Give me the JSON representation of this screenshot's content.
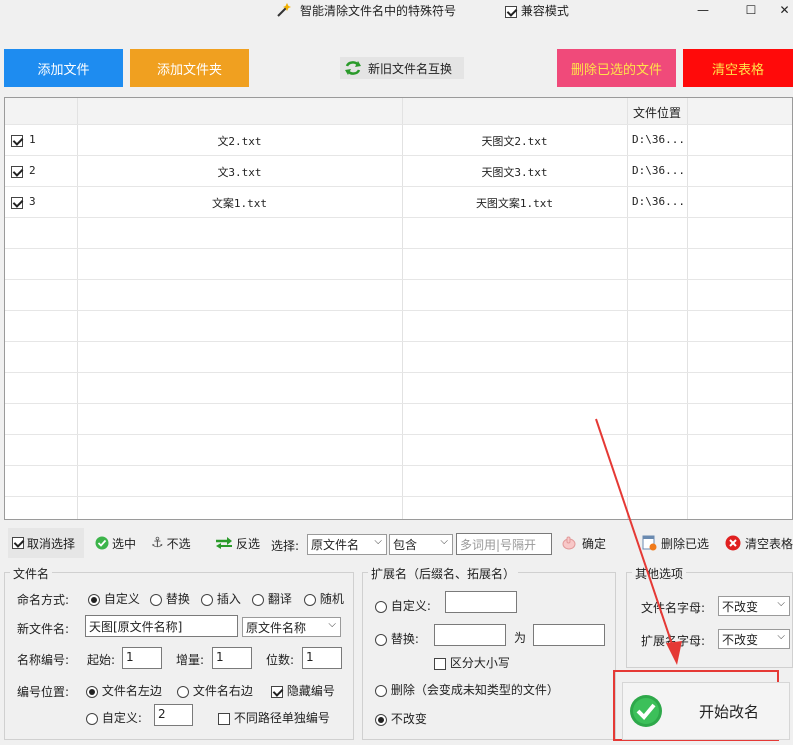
{
  "title": "智能清除文件名中的特殊符号",
  "compat_label": "兼容模式",
  "window": {
    "min": "—",
    "max": "☐",
    "close": "✕"
  },
  "buttons": {
    "add_file": "添加文件",
    "add_folder": "添加文件夹",
    "swap_names": "新旧文件名互换",
    "delete_selected_files": "删除已选的文件",
    "clear_table": "清空表格"
  },
  "colors": {
    "blue": "#1e8cf0",
    "orange": "#f0a020",
    "pink": "#f04a7a",
    "red": "#ff0a0a"
  },
  "table": {
    "headers": [
      "",
      "",
      "",
      "文件位置"
    ],
    "rows": [
      {
        "num": "1",
        "old": "文2.txt",
        "new": "天图文2.txt",
        "path": "D:\\36..."
      },
      {
        "num": "2",
        "old": "文3.txt",
        "new": "天图文3.txt",
        "path": "D:\\36..."
      },
      {
        "num": "3",
        "old": "文案1.txt",
        "new": "天图文案1.txt",
        "path": "D:\\36..."
      }
    ]
  },
  "toolbar": {
    "deselect": "取消选择",
    "select": "选中",
    "unselect": "不选",
    "invert": "反选",
    "choose_label": "选择:",
    "field_select": "原文件名",
    "mode_select": "包含",
    "keyword_placeholder": "多词用|号隔开",
    "confirm": "确定",
    "delete_selected": "删除已选",
    "clear_table": "清空表格"
  },
  "filename_group": {
    "title": "文件名",
    "naming_label": "命名方式:",
    "naming_options": [
      "自定义",
      "替换",
      "插入",
      "翻译",
      "随机"
    ],
    "new_name_label": "新文件名:",
    "new_name_value": "天图[原文件名称]",
    "name_source_select": "原文件名称",
    "numbering_label": "名称编号:",
    "start_label": "起始:",
    "start_value": "1",
    "increment_label": "增量:",
    "increment_value": "1",
    "digits_label": "位数:",
    "digits_value": "1",
    "position_label": "编号位置:",
    "pos_left": "文件名左边",
    "pos_right": "文件名右边",
    "hide_numbering": "隐藏编号",
    "pos_custom": "自定义:",
    "pos_custom_value": "2",
    "separate_path_numbering": "不同路径单独编号"
  },
  "ext_group": {
    "title": "扩展名（后缀名、拓展名）",
    "custom": "自定义:",
    "replace": "替换:",
    "to": "为",
    "case_sensitive": "区分大小写",
    "delete": "删除（会变成未知类型的文件）",
    "no_change": "不改变"
  },
  "other_group": {
    "title": "其他选项",
    "filename_case_label": "文件名字母:",
    "filename_case_value": "不改变",
    "ext_case_label": "扩展名字母:",
    "ext_case_value": "不改变"
  },
  "start_button": "开始改名"
}
